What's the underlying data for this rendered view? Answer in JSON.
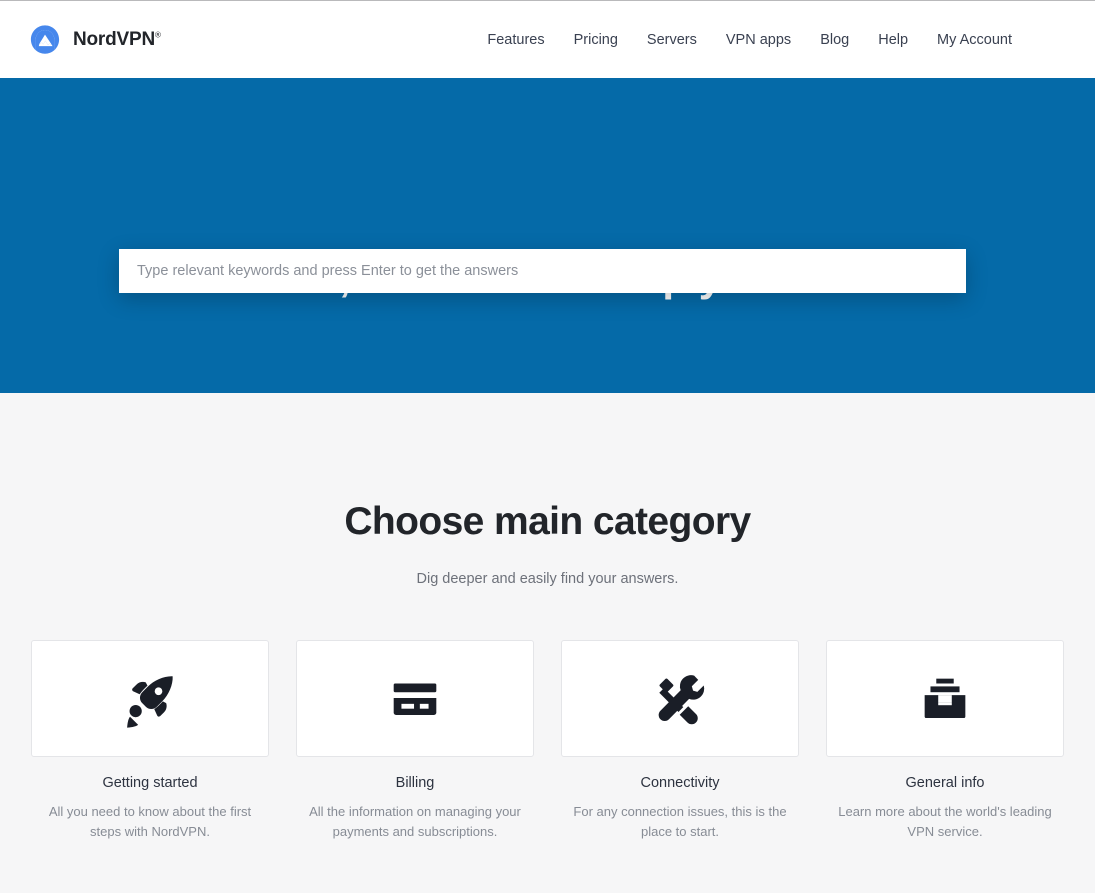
{
  "brand": {
    "name": "NordVPN",
    "trademark": "®",
    "logo_icon": "nordvpn-mountain-logo"
  },
  "nav": {
    "items": [
      {
        "label": "Features"
      },
      {
        "label": "Pricing"
      },
      {
        "label": "Servers"
      },
      {
        "label": "VPN apps"
      },
      {
        "label": "Blog"
      },
      {
        "label": "Help"
      },
      {
        "label": "My Account"
      }
    ]
  },
  "hero": {
    "title": "Hi, how can we help you?",
    "search_placeholder": "Type relevant keywords and press Enter to get the answers",
    "search_value": "",
    "background_color": "#056aa8"
  },
  "main": {
    "title": "Choose main category",
    "subtitle": "Dig deeper and easily find your answers.",
    "cards": [
      {
        "icon": "rocket-icon",
        "title": "Getting started",
        "description": "All you need to know about the first steps with NordVPN."
      },
      {
        "icon": "credit-card-icon",
        "title": "Billing",
        "description": "All the information on managing your payments and subscriptions."
      },
      {
        "icon": "tools-icon",
        "title": "Connectivity",
        "description": "For any connection issues, this is the place to start."
      },
      {
        "icon": "archive-box-icon",
        "title": "General info",
        "description": "Learn more about the world's leading VPN service."
      }
    ]
  },
  "colors": {
    "accent_blue": "#056aa8",
    "logo_blue": "#4687ec",
    "page_background": "#f6f6f7",
    "icon_dark": "#1a1e27",
    "text_dark": "#22252a",
    "text_muted": "#878c95"
  }
}
